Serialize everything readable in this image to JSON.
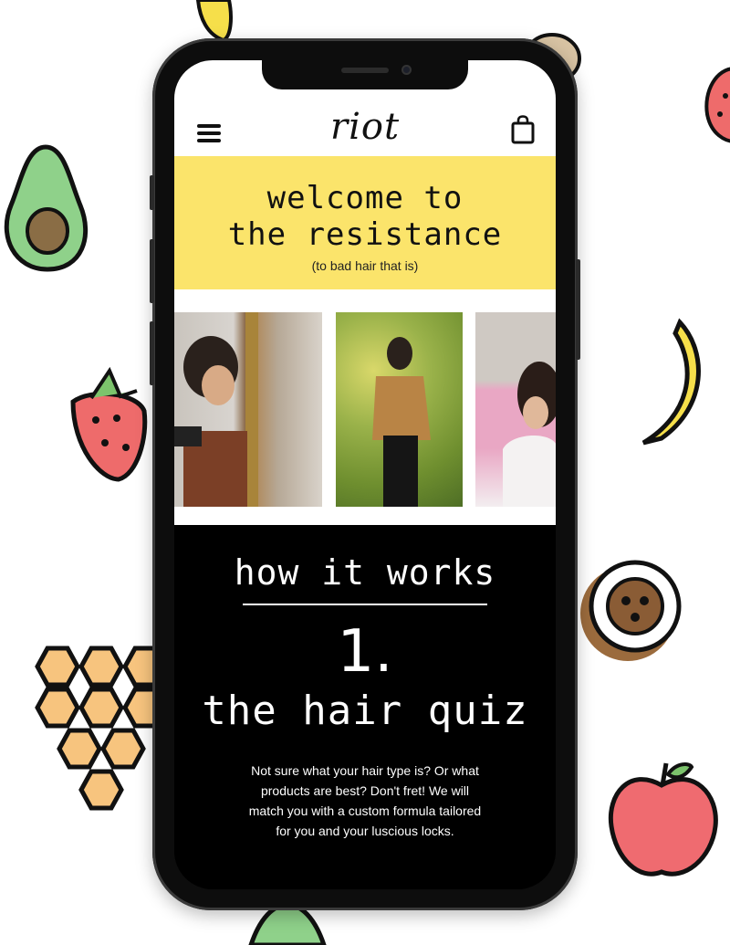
{
  "header": {
    "logo": "riot",
    "menu_icon": "hamburger-menu-icon",
    "cart_icon": "shopping-bag-icon"
  },
  "hero": {
    "title_line1": "welcome to",
    "title_line2": "the resistance",
    "subtitle": "(to bad hair that is)",
    "background": "#fbe46b"
  },
  "gallery": {
    "photos": [
      "photo-girl-with-camera",
      "photo-girl-in-field",
      "photo-girl-pink-stripes"
    ]
  },
  "how_it_works": {
    "heading": "how it works",
    "step_number": "1.",
    "step_title": "the hair quiz",
    "step_description": "Not sure what your hair type is? Or what products are best? Don't fret! We will match you with a custom formula tailored for you and your luscious locks."
  },
  "decorations": [
    "banana-icon",
    "coconut-icon",
    "strawberry-icon",
    "avocado-icon",
    "honeycomb-icon",
    "apple-icon"
  ],
  "colors": {
    "accent_yellow": "#fbe46b",
    "dark": "#000000"
  }
}
